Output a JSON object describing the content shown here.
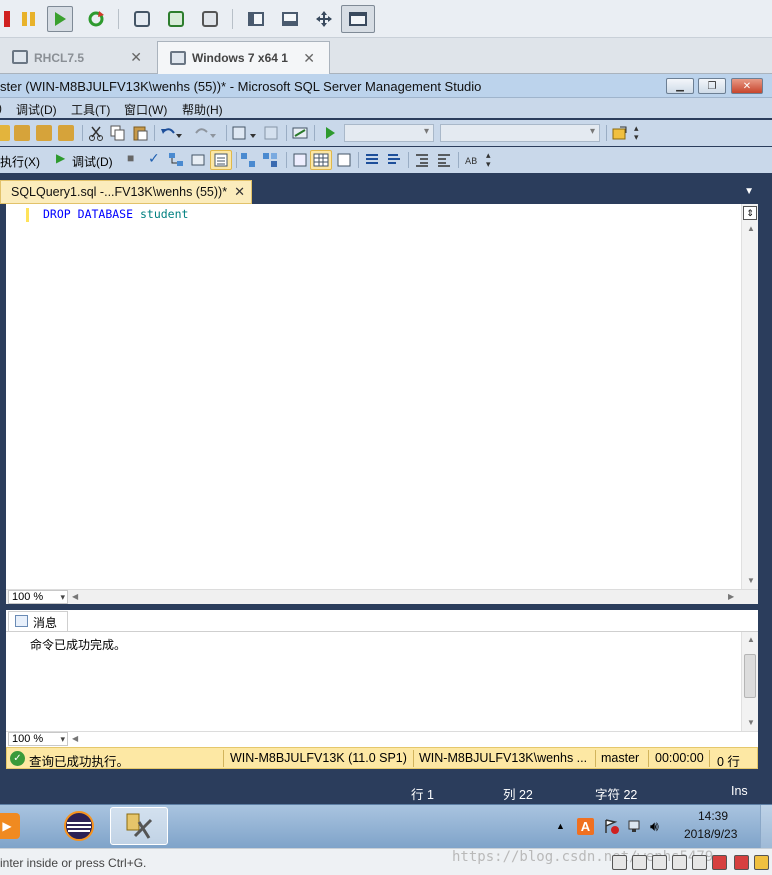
{
  "vmware": {
    "tabs": [
      {
        "label": "RHCL7.5"
      },
      {
        "label": "Windows 7 x64 1"
      }
    ],
    "status_hint": "inter inside or press Ctrl+G."
  },
  "ssms": {
    "title": "ster (WIN-M8BJULFV13K\\wenhs (55))* - Microsoft SQL Server Management Studio",
    "menu": {
      "debug": "调试(D)",
      "tools": "工具(T)",
      "window": "窗口(W)",
      "help": "帮助(H)"
    },
    "toolbar": {
      "execute": "执行(X)",
      "debug": "调试(D)"
    },
    "document_tab": "SQLQuery1.sql -...FV13K\\wenhs (55))*",
    "code": {
      "kw1": "DROP",
      "kw2": "DATABASE",
      "identifier": "student"
    },
    "zoom": "100 %",
    "results": {
      "tab_label": "消息",
      "message": "命令已成功完成。",
      "zoom": "100 %"
    },
    "status": {
      "query_result": "查询已成功执行。",
      "server": "WIN-M8BJULFV13K (11.0 SP1)",
      "login": "WIN-M8BJULFV13K\\wenhs ...",
      "database": "master",
      "elapsed": "00:00:00",
      "rows": "0 行"
    },
    "position": {
      "line": "行 1",
      "col": "列 22",
      "char": "字符 22",
      "mode": "Ins"
    }
  },
  "taskbar": {
    "time": "14:39",
    "date": "2018/9/23"
  },
  "watermark": "https://blog.csdn.net/wenhs5479",
  "colors": {
    "frame": "#2b3d5c",
    "active_tab": "#fbecbc",
    "status_bar": "#fde8a4",
    "keyword": "#0000ff",
    "identifier": "#008080"
  }
}
